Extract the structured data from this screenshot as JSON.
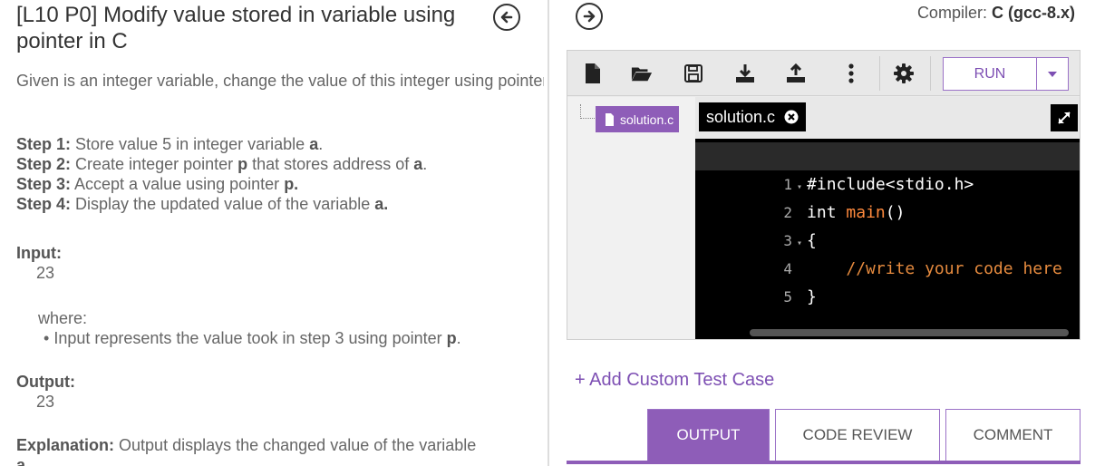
{
  "problem": {
    "title": "[L10 P0] Modify value stored in variable using pointer in C",
    "description": "Given is an integer variable, change the value of this integer using pointers.",
    "steps": [
      {
        "label": "Step 1:",
        "text": "Store value 5 in integer variable ",
        "var": "a",
        "suffix": "."
      },
      {
        "label": "Step 2:",
        "text": "Create integer pointer ",
        "var": "p",
        "mid": " that stores address of ",
        "var2": "a",
        "suffix": "."
      },
      {
        "label": "Step 3:",
        "text": "Accept a value using pointer ",
        "var": "p.",
        "suffix": ""
      },
      {
        "label": "Step 4:",
        "text": "Display the updated value of the variable ",
        "var": "a.",
        "suffix": ""
      }
    ],
    "input_label": "Input:",
    "input_value": "23",
    "where_label": "where:",
    "where_bullet_text": "Input represents the value took in step 3 using pointer ",
    "where_bullet_var": "p",
    "where_bullet_suffix": ".",
    "output_label": "Output:",
    "output_value": "23",
    "explanation_label": "Explanation:",
    "explanation_text": "Output displays the changed value of the variable",
    "explanation_overflow": "a"
  },
  "compiler": {
    "label": "Compiler: ",
    "value": "C (gcc-8.x)"
  },
  "toolbar": {
    "icons": [
      "new-file-icon",
      "open-folder-icon",
      "save-icon",
      "download-icon",
      "upload-icon",
      "more-vertical-icon",
      "settings-gear-icon"
    ],
    "run_label": "RUN"
  },
  "file_tree": {
    "file": "solution.c"
  },
  "editor": {
    "tab_label": "solution.c",
    "lines": [
      {
        "n": "1",
        "fold": "▾",
        "code": "#include<stdio.h>"
      },
      {
        "n": "2",
        "fold": "",
        "code": "int main()"
      },
      {
        "n": "3",
        "fold": "▾",
        "code": "{"
      },
      {
        "n": "4",
        "fold": "",
        "code": "    //write your code here"
      },
      {
        "n": "5",
        "fold": "",
        "code": "}"
      }
    ]
  },
  "add_test_case": "+ Add Custom Test Case",
  "result_tabs": [
    {
      "label": "OUTPUT",
      "active": true
    },
    {
      "label": "CODE REVIEW",
      "active": false
    },
    {
      "label": "COMMENT",
      "active": false
    }
  ],
  "colors": {
    "accent": "#8e5db8",
    "comment": "#e58a3e",
    "function": "#ff8a3d"
  }
}
